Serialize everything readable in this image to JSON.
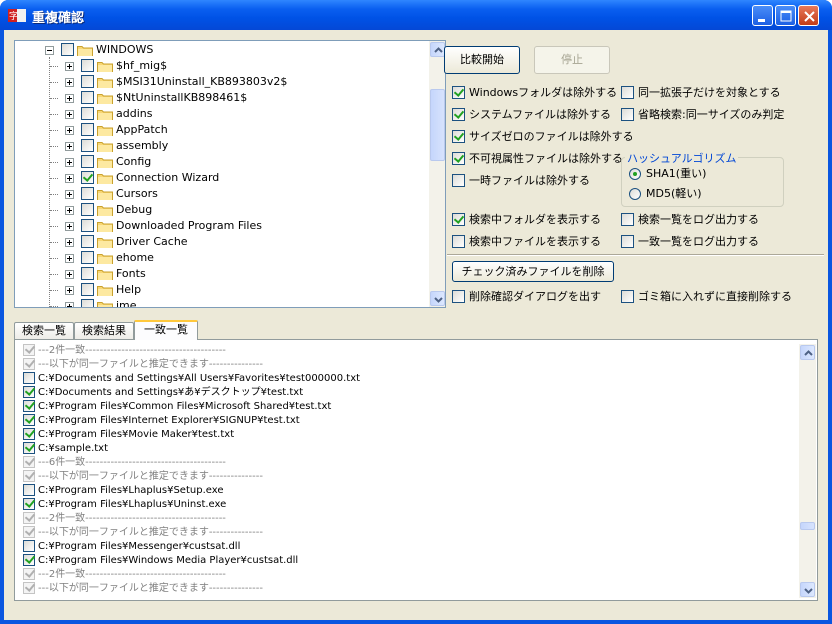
{
  "window": {
    "title": "重複確認"
  },
  "tree": {
    "items": [
      {
        "label": "WINDOWS",
        "checked": false,
        "root": true
      },
      {
        "label": "$hf_mig$",
        "checked": false
      },
      {
        "label": "$MSI31Uninstall_KB893803v2$",
        "checked": false
      },
      {
        "label": "$NtUninstallKB898461$",
        "checked": false
      },
      {
        "label": "addins",
        "checked": false
      },
      {
        "label": "AppPatch",
        "checked": false
      },
      {
        "label": "assembly",
        "checked": false
      },
      {
        "label": "Config",
        "checked": false
      },
      {
        "label": "Connection Wizard",
        "checked": true
      },
      {
        "label": "Cursors",
        "checked": false
      },
      {
        "label": "Debug",
        "checked": false
      },
      {
        "label": "Downloaded Program Files",
        "checked": false
      },
      {
        "label": "Driver Cache",
        "checked": false
      },
      {
        "label": "ehome",
        "checked": false
      },
      {
        "label": "Fonts",
        "checked": false
      },
      {
        "label": "Help",
        "checked": false
      },
      {
        "label": "ime",
        "checked": false
      }
    ]
  },
  "buttons": {
    "compare": "比較開始",
    "stop": "停止",
    "delete_checked": "チェック済みファイルを削除"
  },
  "options": {
    "exclude_windows": {
      "label": "Windowsフォルダは除外する",
      "checked": true
    },
    "same_ext_only": {
      "label": "同一拡張子だけを対象とする",
      "checked": false
    },
    "exclude_system": {
      "label": "システムファイルは除外する",
      "checked": true
    },
    "quick_search": {
      "label": "省略検索:同一サイズのみ判定",
      "checked": false
    },
    "exclude_zero": {
      "label": "サイズゼロのファイルは除外する",
      "checked": true
    },
    "exclude_hidden": {
      "label": "不可視属性ファイルは除外する",
      "checked": true
    },
    "exclude_temp": {
      "label": "一時ファイルは除外する",
      "checked": false
    },
    "show_folder": {
      "label": "検索中フォルダを表示する",
      "checked": true
    },
    "log_search": {
      "label": "検索一覧をログ出力する",
      "checked": false
    },
    "show_file": {
      "label": "検索中ファイルを表示する",
      "checked": false
    },
    "log_match": {
      "label": "一致一覧をログ出力する",
      "checked": false
    },
    "confirm_delete": {
      "label": "削除確認ダイアログを出す",
      "checked": false
    },
    "direct_delete": {
      "label": "ゴミ箱に入れずに直接削除する",
      "checked": false
    }
  },
  "hash": {
    "title": "ハッシュアルゴリズム",
    "options": [
      {
        "label": "SHA1(重い)",
        "selected": true
      },
      {
        "label": "MD5(軽い)",
        "selected": false
      }
    ]
  },
  "tabs": [
    {
      "label": "検索一覧",
      "active": false
    },
    {
      "label": "検索結果",
      "active": false
    },
    {
      "label": "一致一覧",
      "active": true
    }
  ],
  "results": [
    {
      "text": "---2件一致---------------------------------------",
      "checked": true,
      "grey": true
    },
    {
      "text": "---以下が同一ファイルと推定できます---------------",
      "checked": true,
      "grey": true
    },
    {
      "text": "C:¥Documents and Settings¥All Users¥Favorites¥test000000.txt",
      "checked": false,
      "grey": false
    },
    {
      "text": "C:¥Documents and Settings¥あ¥デスクトップ¥test.txt",
      "checked": true,
      "grey": false
    },
    {
      "text": "C:¥Program Files¥Common Files¥Microsoft Shared¥test.txt",
      "checked": true,
      "grey": false
    },
    {
      "text": "C:¥Program Files¥Internet Explorer¥SIGNUP¥test.txt",
      "checked": true,
      "grey": false
    },
    {
      "text": "C:¥Program Files¥Movie Maker¥test.txt",
      "checked": true,
      "grey": false
    },
    {
      "text": "C:¥sample.txt",
      "checked": true,
      "grey": false
    },
    {
      "text": "---6件一致---------------------------------------",
      "checked": true,
      "grey": true
    },
    {
      "text": "---以下が同一ファイルと推定できます---------------",
      "checked": true,
      "grey": true
    },
    {
      "text": "C:¥Program Files¥Lhaplus¥Setup.exe",
      "checked": false,
      "grey": false
    },
    {
      "text": "C:¥Program Files¥Lhaplus¥Uninst.exe",
      "checked": true,
      "grey": false
    },
    {
      "text": "---2件一致---------------------------------------",
      "checked": true,
      "grey": true
    },
    {
      "text": "---以下が同一ファイルと推定できます---------------",
      "checked": true,
      "grey": true
    },
    {
      "text": "C:¥Program Files¥Messenger¥custsat.dll",
      "checked": false,
      "grey": false
    },
    {
      "text": "C:¥Program Files¥Windows Media Player¥custsat.dll",
      "checked": true,
      "grey": false
    },
    {
      "text": "---2件一致---------------------------------------",
      "checked": true,
      "grey": true
    },
    {
      "text": "---以下が同一ファイルと推定できます---------------",
      "checked": true,
      "grey": true
    }
  ]
}
